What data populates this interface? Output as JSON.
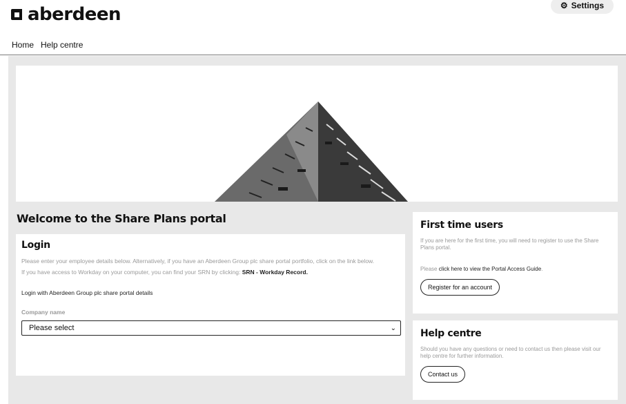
{
  "header": {
    "logo_text": "aberdeen",
    "settings_label": "Settings",
    "settings_icon": "gear-icon"
  },
  "nav": {
    "items": [
      {
        "label": "Home"
      },
      {
        "label": "Help centre"
      }
    ]
  },
  "hero": {
    "image": "building-pyramid-photo"
  },
  "welcome": {
    "title": "Welcome to the Share Plans portal"
  },
  "login": {
    "title": "Login",
    "intro": "Please enter your employee details below. Alternatively, if you have an Aberdeen Group plc share portal portfolio, click on the link below.",
    "workday_text": "If you have access to Workday on your computer, you can find your SRN by clicking: ",
    "workday_link": "SRN - Workday Record.",
    "login_with": "Login with Aberdeen Group plc share portal details",
    "company_label": "Company name",
    "company_value": "Please select"
  },
  "first_time": {
    "title": "First time users",
    "text": "If you are here for the first time, you will need to register to use the Share Plans portal.",
    "please_prefix": "Please ",
    "guide_link": "click here to view the Portal Access Guide",
    "please_suffix": ".",
    "register_label": "Register for an account"
  },
  "help": {
    "title": "Help centre",
    "text": "Should you have any questions or need to contact us then please visit our help centre for further information.",
    "contact_label": "Contact us"
  },
  "colors": {
    "background": "#e8e8e8",
    "card": "#ffffff",
    "muted_text": "#999999",
    "text": "#111111"
  }
}
